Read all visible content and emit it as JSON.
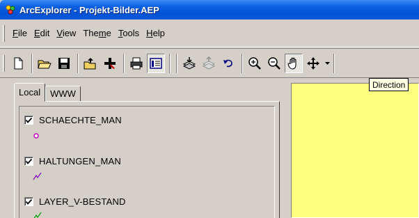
{
  "window": {
    "title": "ArcExplorer - Projekt-Bilder.AEP"
  },
  "menu": {
    "items": [
      {
        "label": "File",
        "accel": "F"
      },
      {
        "label": "Edit",
        "accel": "E"
      },
      {
        "label": "View",
        "accel": "V"
      },
      {
        "label": "Theme",
        "accel": "m"
      },
      {
        "label": "Tools",
        "accel": "T"
      },
      {
        "label": "Help",
        "accel": "H"
      }
    ]
  },
  "toolbar": {
    "buttons": [
      "new-icon",
      "open-icon",
      "save-icon",
      "open-folder-up-icon",
      "add-theme-icon",
      "print-icon",
      "legend-toggle-icon",
      "import-layer-icon",
      "export-layer-icon",
      "undo-icon",
      "zoom-in-icon",
      "zoom-out-icon",
      "pan-hand-icon",
      "direction-icon"
    ]
  },
  "tooltip": {
    "text": "Direction"
  },
  "tabs": [
    {
      "label": "Local",
      "active": true
    },
    {
      "label": "WWW",
      "active": false
    }
  ],
  "layers": [
    {
      "name": "SCHAECHTE_MAN",
      "checked": true,
      "symbol": "point",
      "color": "#c000c0"
    },
    {
      "name": "HALTUNGEN_MAN",
      "checked": true,
      "symbol": "line",
      "color": "#8000c0"
    },
    {
      "name": "LAYER_V-BESTAND",
      "checked": true,
      "symbol": "line",
      "color": "#00a000"
    }
  ],
  "map": {
    "background_color": "#ffff80"
  }
}
